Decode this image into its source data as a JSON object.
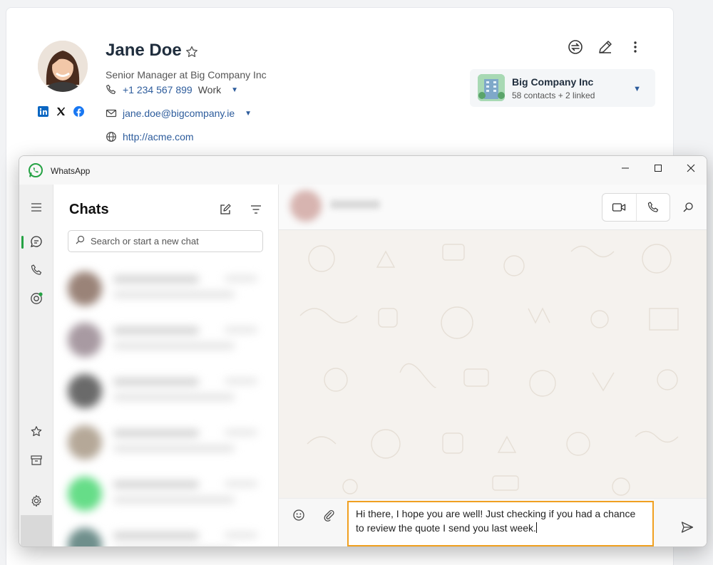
{
  "contact": {
    "name": "Jane Doe",
    "title": "Senior Manager at Big Company Inc",
    "phone": "+1 234 567 899",
    "phone_type": "Work",
    "email": "jane.doe@bigcompany.ie",
    "website": "http://acme.com",
    "socials": [
      "linkedin-icon",
      "x-icon",
      "facebook-icon"
    ]
  },
  "company": {
    "name": "Big Company Inc",
    "meta": "58 contacts + 2 linked"
  },
  "whatsapp": {
    "app_title": "WhatsApp",
    "chats_title": "Chats",
    "search_placeholder": "Search or start a new chat",
    "message_draft": "Hi there, I hope you are well! Just checking if you had a chance to review the quote I send you last week."
  },
  "colors": {
    "accent_green": "#25a244",
    "link_blue": "#2d5c9c",
    "highlight_orange": "#f0a020"
  }
}
